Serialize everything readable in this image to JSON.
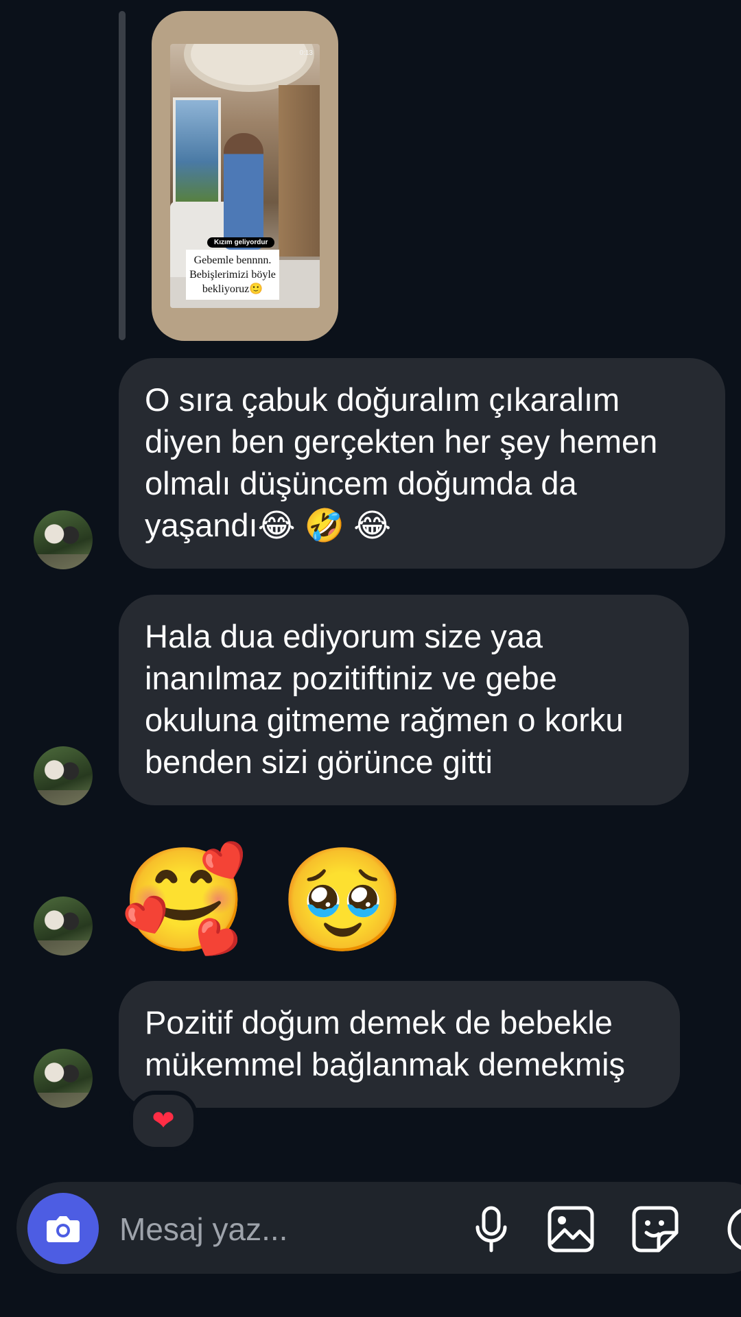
{
  "story": {
    "time": "0:13",
    "tag": "Kızım geliyordur",
    "caption_lines": [
      "Gebemle bennnn.",
      "Bebişlerimizi böyle",
      "bekliyoruz🙂"
    ]
  },
  "messages": [
    {
      "lines": [
        "O sıra çabuk doğuralım çıkaralım",
        "diyen ben gerçekten her şey hemen",
        "olmalı düşüncem doğumda da",
        "yaşandı😂 🤣 😂"
      ]
    },
    {
      "lines": [
        "Hala dua ediyorum size yaa",
        "inanılmaz pozitiftiniz ve gebe",
        "okuluna gitmeme rağmen o korku",
        "benden sizi görünce gitti"
      ]
    },
    {
      "emoji": "🥰 🥹"
    },
    {
      "lines": [
        "Pozitif doğum demek de bebekle",
        "mükemmel bağlanmak demekmiş"
      ],
      "reaction": "❤"
    }
  ],
  "composer": {
    "placeholder": "Mesaj yaz...",
    "icons": [
      "camera-icon",
      "microphone-icon",
      "gallery-icon",
      "sticker-icon",
      "plus-icon"
    ]
  }
}
